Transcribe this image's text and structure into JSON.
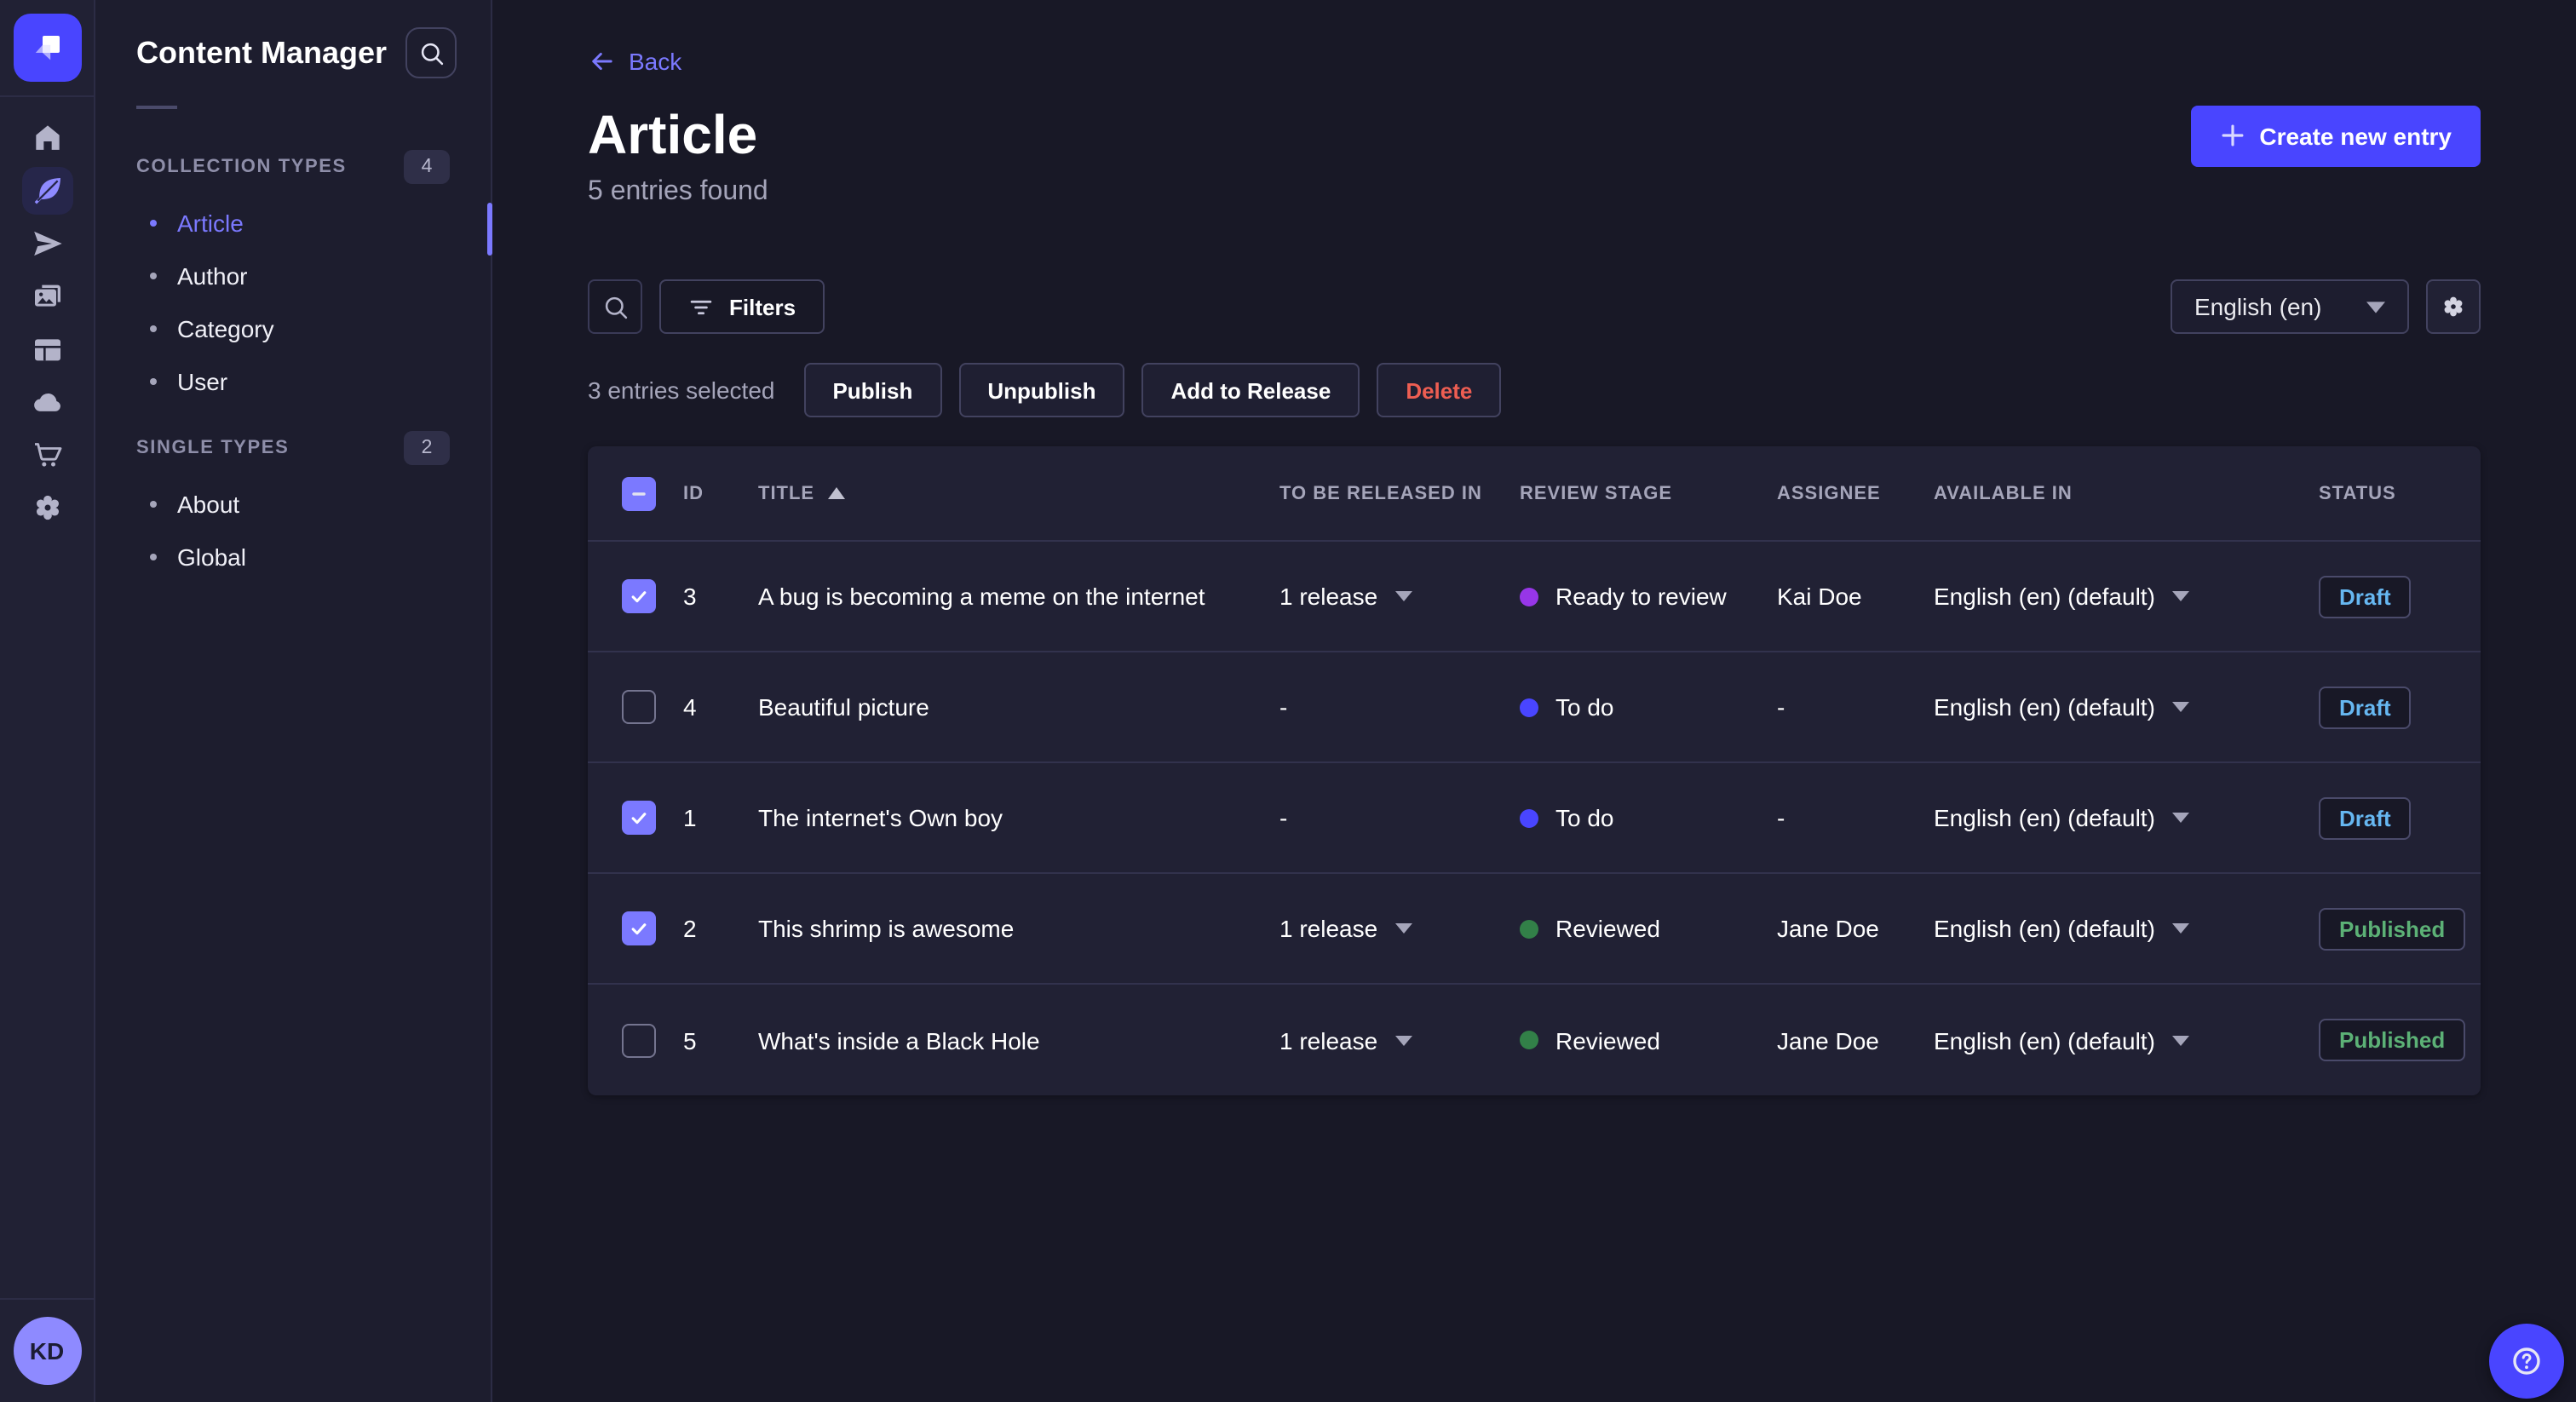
{
  "rail": {
    "icons": [
      "home-icon",
      "content-manager-feather-icon",
      "releases-send-icon",
      "media-library-icon",
      "content-type-builder-icon",
      "deploy-cloud-icon",
      "marketplace-cart-icon",
      "settings-gear-icon"
    ],
    "avatar_initials": "KD"
  },
  "sidebar": {
    "title": "Content Manager",
    "sections": [
      {
        "label": "COLLECTION TYPES",
        "count": "4",
        "items": [
          {
            "label": "Article",
            "active": true
          },
          {
            "label": "Author"
          },
          {
            "label": "Category"
          },
          {
            "label": "User"
          }
        ]
      },
      {
        "label": "SINGLE TYPES",
        "count": "2",
        "items": [
          {
            "label": "About"
          },
          {
            "label": "Global"
          }
        ]
      }
    ]
  },
  "header": {
    "back_label": "Back",
    "title": "Article",
    "subtitle": "5 entries found",
    "create_button_label": "Create new entry"
  },
  "toolbar": {
    "filters_label": "Filters",
    "locale": "English (en)"
  },
  "selection": {
    "text": "3 entries selected",
    "actions": [
      {
        "label": "Publish"
      },
      {
        "label": "Unpublish"
      },
      {
        "label": "Add to Release"
      },
      {
        "label": "Delete",
        "danger": true
      }
    ]
  },
  "table": {
    "headers": {
      "id": "ID",
      "title": "TITLE",
      "released": "TO BE RELEASED IN",
      "review": "REVIEW STAGE",
      "assignee": "ASSIGNEE",
      "available": "AVAILABLE IN",
      "status": "STATUS"
    },
    "sort": {
      "column": "TITLE",
      "direction": "asc"
    },
    "rows": [
      {
        "checked": true,
        "id": "3",
        "title": "A bug is becoming a meme on the internet",
        "released": "1 release",
        "review": {
          "label": "Ready to review",
          "color": "#9736e8"
        },
        "assignee": "Kai Doe",
        "available": "English (en) (default)",
        "status": {
          "label": "Draft",
          "color": "#66b7f1"
        }
      },
      {
        "checked": false,
        "id": "4",
        "title": "Beautiful picture",
        "released": "-",
        "review": {
          "label": "To do",
          "color": "#4945ff"
        },
        "assignee": "-",
        "available": "English (en) (default)",
        "status": {
          "label": "Draft",
          "color": "#66b7f1"
        }
      },
      {
        "checked": true,
        "id": "1",
        "title": "The internet's Own boy",
        "released": "-",
        "review": {
          "label": "To do",
          "color": "#4945ff"
        },
        "assignee": "-",
        "available": "English (en) (default)",
        "status": {
          "label": "Draft",
          "color": "#66b7f1"
        }
      },
      {
        "checked": true,
        "id": "2",
        "title": "This shrimp is awesome",
        "released": "1 release",
        "review": {
          "label": "Reviewed",
          "color": "#328048"
        },
        "assignee": "Jane Doe",
        "available": "English (en) (default)",
        "status": {
          "label": "Published",
          "color": "#5cb176"
        }
      },
      {
        "checked": false,
        "id": "5",
        "title": "What's inside a Black Hole",
        "released": "1 release",
        "review": {
          "label": "Reviewed",
          "color": "#328048"
        },
        "assignee": "Jane Doe",
        "available": "English (en) (default)",
        "status": {
          "label": "Published",
          "color": "#5cb176"
        }
      }
    ]
  },
  "colors": {
    "accent": "#4945ff",
    "accent_light": "#7b79ff",
    "draft": "#66b7f1",
    "published": "#5cb176",
    "danger": "#ee5e52",
    "page_bg": "#181826",
    "card_bg": "#212134"
  }
}
